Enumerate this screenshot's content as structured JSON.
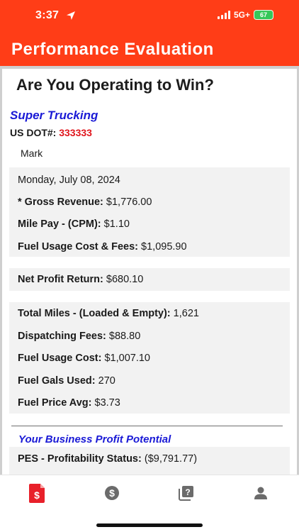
{
  "status_bar": {
    "time": "3:37",
    "network": "5G+",
    "battery": "67"
  },
  "app": {
    "title": "Performance Evaluation"
  },
  "page": {
    "heading": "Are You Operating to Win?",
    "company": "Super Trucking",
    "dot_label": "US DOT#:",
    "dot_number": "333333",
    "driver": "Mark"
  },
  "summary": {
    "date": "Monday, July 08, 2024",
    "gross_revenue": {
      "label": "* Gross Revenue:",
      "value": "$1,776.00"
    },
    "mile_pay": {
      "label": "Mile Pay - (CPM):",
      "value": "$1.10"
    },
    "fuel_usage_fees": {
      "label": "Fuel Usage Cost & Fees:",
      "value": "$1,095.90"
    }
  },
  "net_profit": {
    "label": "Net Profit Return:",
    "value": "$680.10"
  },
  "details": {
    "total_miles": {
      "label": "Total Miles - (Loaded & Empty):",
      "value": "1,621"
    },
    "dispatching_fees": {
      "label": "Dispatching Fees:",
      "value": "$88.80"
    },
    "fuel_usage_cost": {
      "label": "Fuel Usage Cost:",
      "value": "$1,007.10"
    },
    "fuel_gals": {
      "label": "Fuel Gals Used:",
      "value": "270"
    },
    "fuel_price_avg": {
      "label": "Fuel Price Avg:",
      "value": "$3.73"
    }
  },
  "potential": {
    "heading": "Your Business Profit Potential",
    "pes": {
      "label": "PES - Profitability Status:",
      "value": "($9,791.77)"
    }
  },
  "tabs": [
    {
      "icon": "invoice-icon",
      "active": true
    },
    {
      "icon": "dollar-coin-icon",
      "active": false
    },
    {
      "icon": "help-book-icon",
      "active": false
    },
    {
      "icon": "person-icon",
      "active": false
    }
  ],
  "colors": {
    "header": "#ff3d17",
    "accent_blue": "#1a1ad6",
    "dot_red": "#e0161d",
    "active_tab": "#e8202a",
    "inactive_tab": "#6b6b6b",
    "card_bg": "#f2f2f2"
  }
}
